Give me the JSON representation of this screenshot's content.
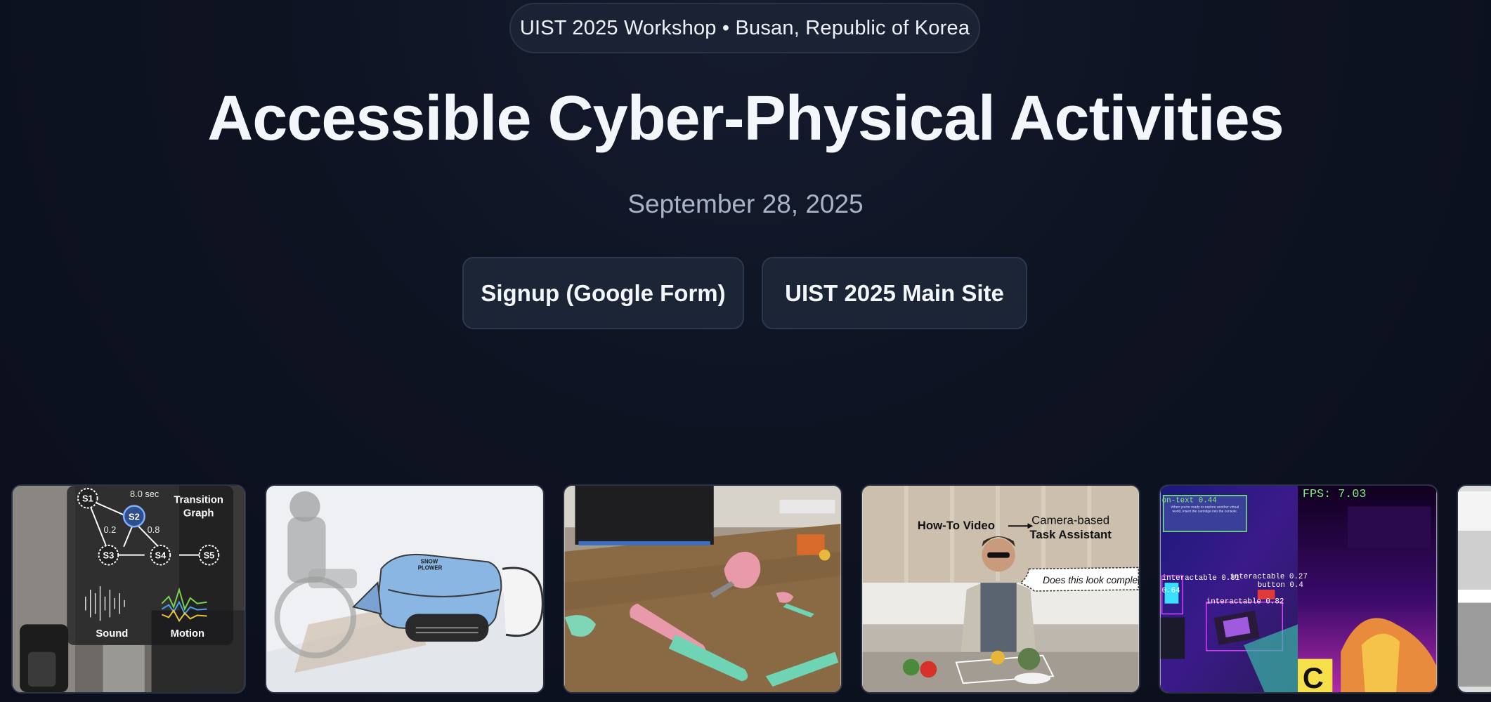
{
  "header": {
    "badge": "UIST 2025 Workshop • Busan, Republic of Korea",
    "title": "Accessible Cyber-Physical Activities",
    "date": "September 28, 2025"
  },
  "actions": {
    "signup_label": "Signup (Google Form)",
    "main_site_label": "UIST 2025 Main Site"
  },
  "gallery": {
    "card1": {
      "graph_title_line1": "Transition",
      "graph_title_line2": "Graph",
      "duration": "8.0 sec",
      "nodes": [
        "S1",
        "S2",
        "S3",
        "S4",
        "S5"
      ],
      "edge_weights": [
        "0.2",
        "0.8"
      ],
      "labels": [
        "Sound",
        "Motion"
      ]
    },
    "card2": {
      "device_text_line1": "SNOW",
      "device_text_line2": "PLOWER"
    },
    "card4": {
      "left_label": "How-To Video",
      "right_label_line1": "Camera-based",
      "right_label_line2": "Task Assistant",
      "speech": "Does this look complete"
    },
    "card5": {
      "fps": "FPS: 7.03",
      "det_text": "on-text 0.44",
      "det_a": "interactable 0.81",
      "det_b": "interactable 0.27",
      "det_c": "button 0.4",
      "det_d": "interactable 0.82",
      "det_e": "0.64",
      "panel_letter": "C",
      "screen_text": "When you're ready to explore another virtual world, insert the cartridge into the console."
    }
  }
}
